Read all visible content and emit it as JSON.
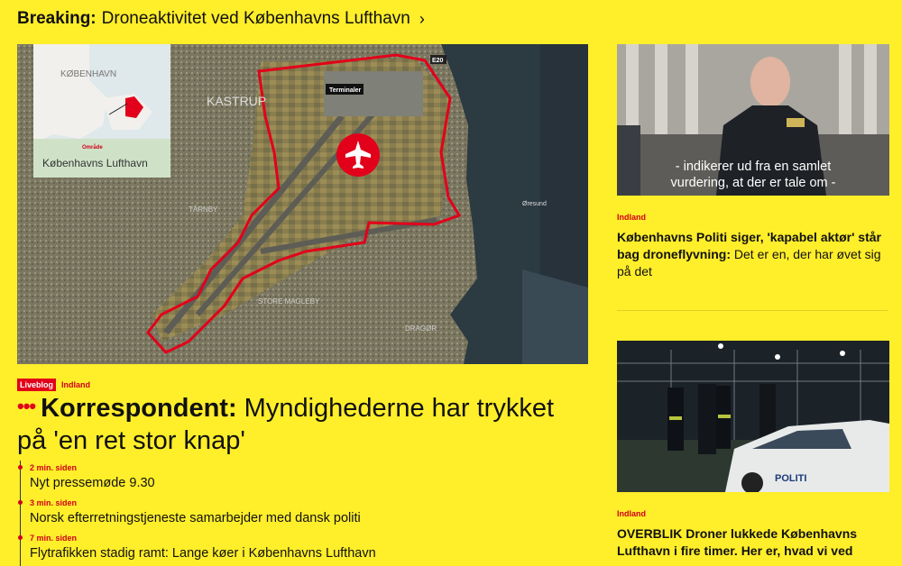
{
  "breaking": {
    "label": "Breaking:",
    "text": "Droneaktivitet ved Københavns Lufthavn",
    "chevron": "›"
  },
  "map": {
    "inset_city": "KØBENHAVN",
    "inset_area_caption": "Område",
    "inset_area_name": "Københavns Lufthavn",
    "labels": {
      "kastrup": "KASTRUP",
      "terminaler": "Terminaler",
      "e20": "E20",
      "oresund": "Øresund",
      "tarnby": "TÅRNBY",
      "store_magleby": "STORE MAGLEBY",
      "dragor": "DRAGØR"
    },
    "icon": "airplane-icon"
  },
  "main_article": {
    "badge": "Liveblog",
    "category": "Indland",
    "headline_bold": "Korrespondent:",
    "headline_rest": " Myndighederne har trykket på 'en ret stor knap'",
    "updates": [
      {
        "time": "2 min. siden",
        "text": "Nyt pressemøde 9.30"
      },
      {
        "time": "3 min. siden",
        "text": "Norsk efterretningstjeneste samarbejder med dansk politi"
      },
      {
        "time": "7 min. siden",
        "text": "Flytrafikken stadig ramt: Lange køer i Københavns Lufthavn"
      }
    ]
  },
  "side_articles": [
    {
      "subtitle_line1": "- indikerer ud fra en samlet",
      "subtitle_line2": "vurdering, at der er tale om -",
      "category": "Indland",
      "title_bold": "Københavns Politi siger, 'kapabel aktør' står bag droneflyvning:",
      "title_rest": " Det er en, der har øvet sig på det"
    },
    {
      "vehicle_text": "POLITI",
      "category": "Indland",
      "title_bold": "OVERBLIK Droner lukkede Københavns Lufthavn i fire timer. Her er, hvad vi ved",
      "title_rest": ""
    }
  ],
  "colors": {
    "background": "#ffee2a",
    "accent": "#e2001a"
  }
}
